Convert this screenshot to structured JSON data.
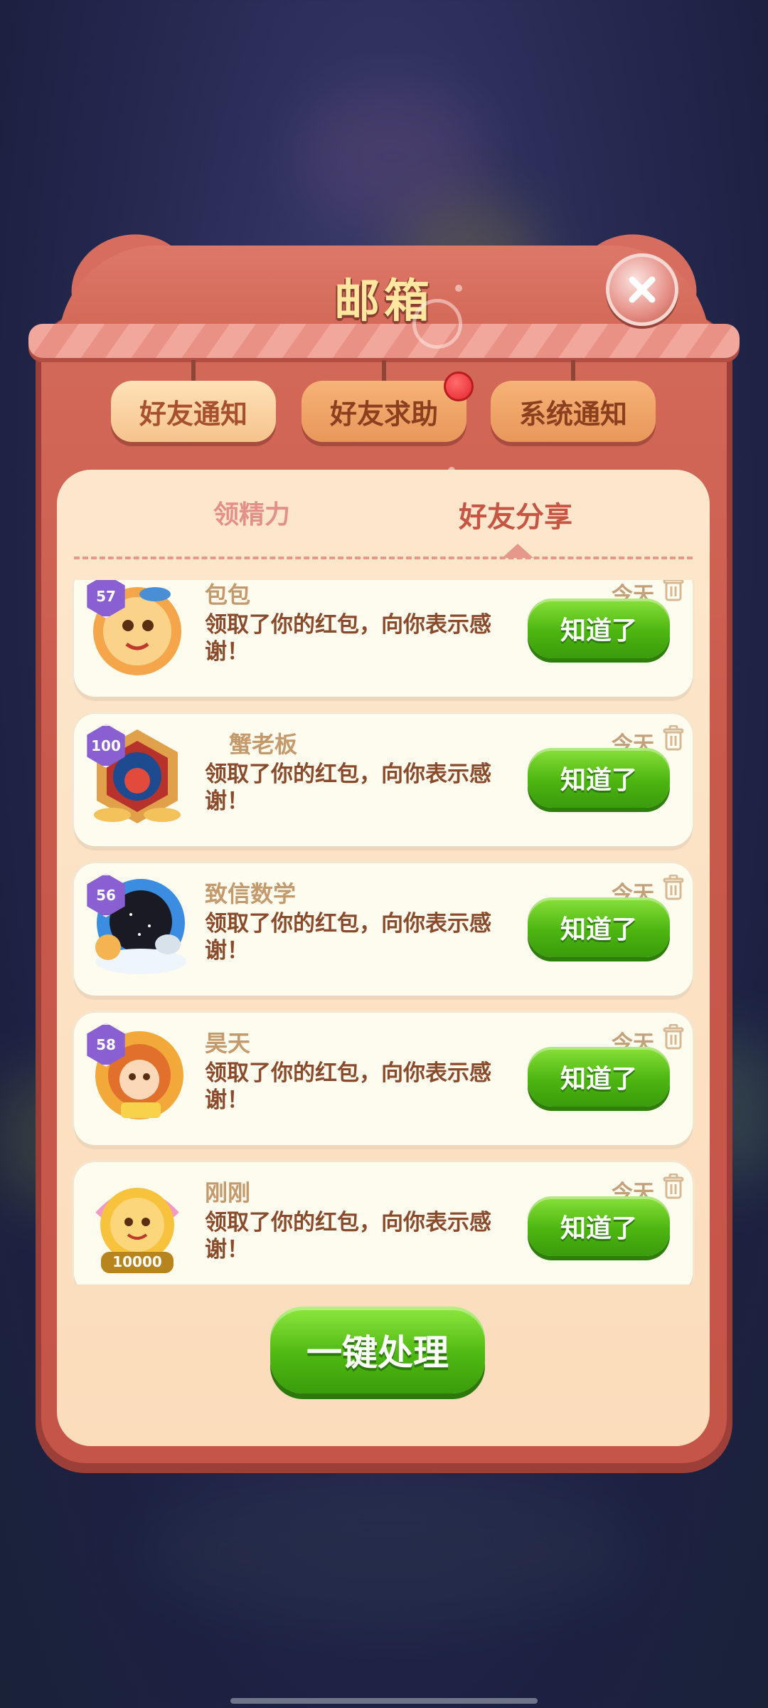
{
  "dialog": {
    "title": "邮箱",
    "close_icon": "close-x-icon"
  },
  "tabs": [
    {
      "label": "好友通知",
      "selected": true
    },
    {
      "label": "好友求助",
      "selected": false,
      "badge": "red-dot"
    },
    {
      "label": "系统通知",
      "selected": false
    }
  ],
  "subtabs": [
    {
      "label": "领精力",
      "selected": false
    },
    {
      "label": "好友分享",
      "selected": true
    }
  ],
  "messages": [
    {
      "name": "包包",
      "level": "57",
      "time": "今天",
      "text": "领取了你的红包，向你表示感谢！",
      "button": "知道了",
      "avatar_color": "#f6a64a"
    },
    {
      "name": "蟹老板",
      "level": "100",
      "time": "今天",
      "text": "领取了你的红包，向你表示感谢！",
      "button": "知道了",
      "avatar_color": "#d1443a"
    },
    {
      "name": "致信数学",
      "level": "56",
      "time": "今天",
      "text": "领取了你的红包，向你表示感谢！",
      "button": "知道了",
      "avatar_color": "#3a8de0"
    },
    {
      "name": "昊天",
      "level": "58",
      "time": "今天",
      "text": "领取了你的红包，向你表示感谢！",
      "button": "知道了",
      "avatar_color": "#f2a93a"
    },
    {
      "name": "刚刚",
      "level": "10000",
      "time": "今天",
      "text": "领取了你的红包，向你表示感谢！",
      "button": "知道了",
      "avatar_color": "#f7c23c"
    }
  ],
  "footer": {
    "button_label": "一键处理"
  }
}
